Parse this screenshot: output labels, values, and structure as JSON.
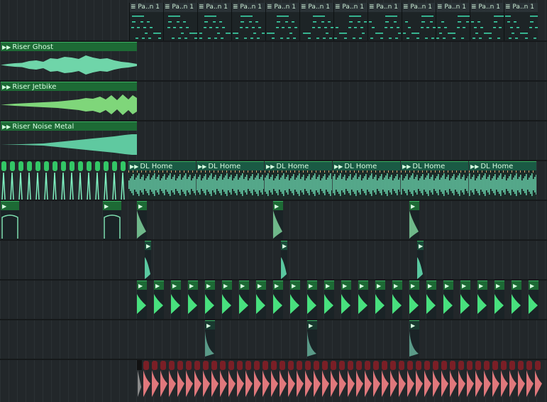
{
  "playlist": {
    "accent_color": "#33cc66",
    "clip_header_color": "#1d6a35",
    "pattern_note_color": "#3ee0b0",
    "red_clip_color": "#e0787c"
  },
  "pattern_clips": {
    "label": "Pa..n 1",
    "count": 12,
    "icon": "pattern-icon"
  },
  "audio_clips": [
    {
      "label": "Riser Ghost",
      "icon": "audio-clip-icon"
    },
    {
      "label": "Riser Jetbike",
      "icon": "audio-clip-icon"
    },
    {
      "label": "Riser Noise Metal",
      "icon": "audio-clip-icon"
    }
  ],
  "dl_home_clips": {
    "label": "DL Home",
    "count": 6,
    "icon": "audio-clip-icon"
  }
}
